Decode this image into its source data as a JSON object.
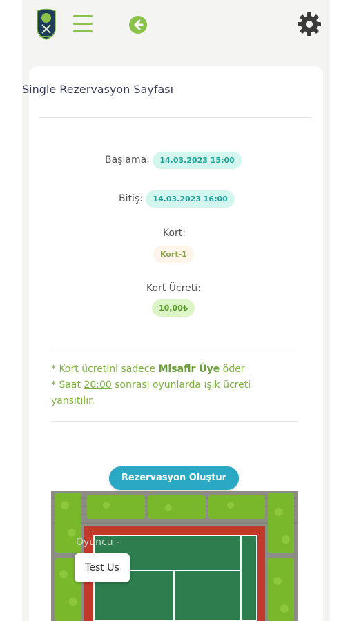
{
  "header": {
    "logo_text": "",
    "menu_icon": "hamburger-menu-icon",
    "back_icon": "back-arrow-icon",
    "settings_icon": "gear-icon"
  },
  "page": {
    "title": "Single Rezervasyon Sayfası"
  },
  "reservation": {
    "start_label": "Başlama:",
    "start_value": "14.03.2023 15:00",
    "end_label": "Bitiş:",
    "end_value": "14.03.2023 16:00",
    "court_label": "Kort:",
    "court_value": "Kort-1",
    "fee_label": "Kort Ücreti:",
    "fee_value": "10,00₺"
  },
  "notes": {
    "line1_prefix": "* Kort ücretini sadece ",
    "line1_bold": "Misafir Üye",
    "line1_suffix": " öder",
    "line2_prefix": "* Saat ",
    "line2_time": "20:00",
    "line2_suffix": " sonrası oyunlarda ışık ücreti yansıtılır."
  },
  "actions": {
    "create_button": "Rezervasyon Oluştur"
  },
  "court_view": {
    "player_label": "Oyuncu -",
    "player_name": "Test Us"
  },
  "colors": {
    "accent_green": "#8bc34a",
    "teal_button": "#2aa8c4",
    "court_green": "#2e7d4f",
    "court_red": "#c0392b"
  }
}
